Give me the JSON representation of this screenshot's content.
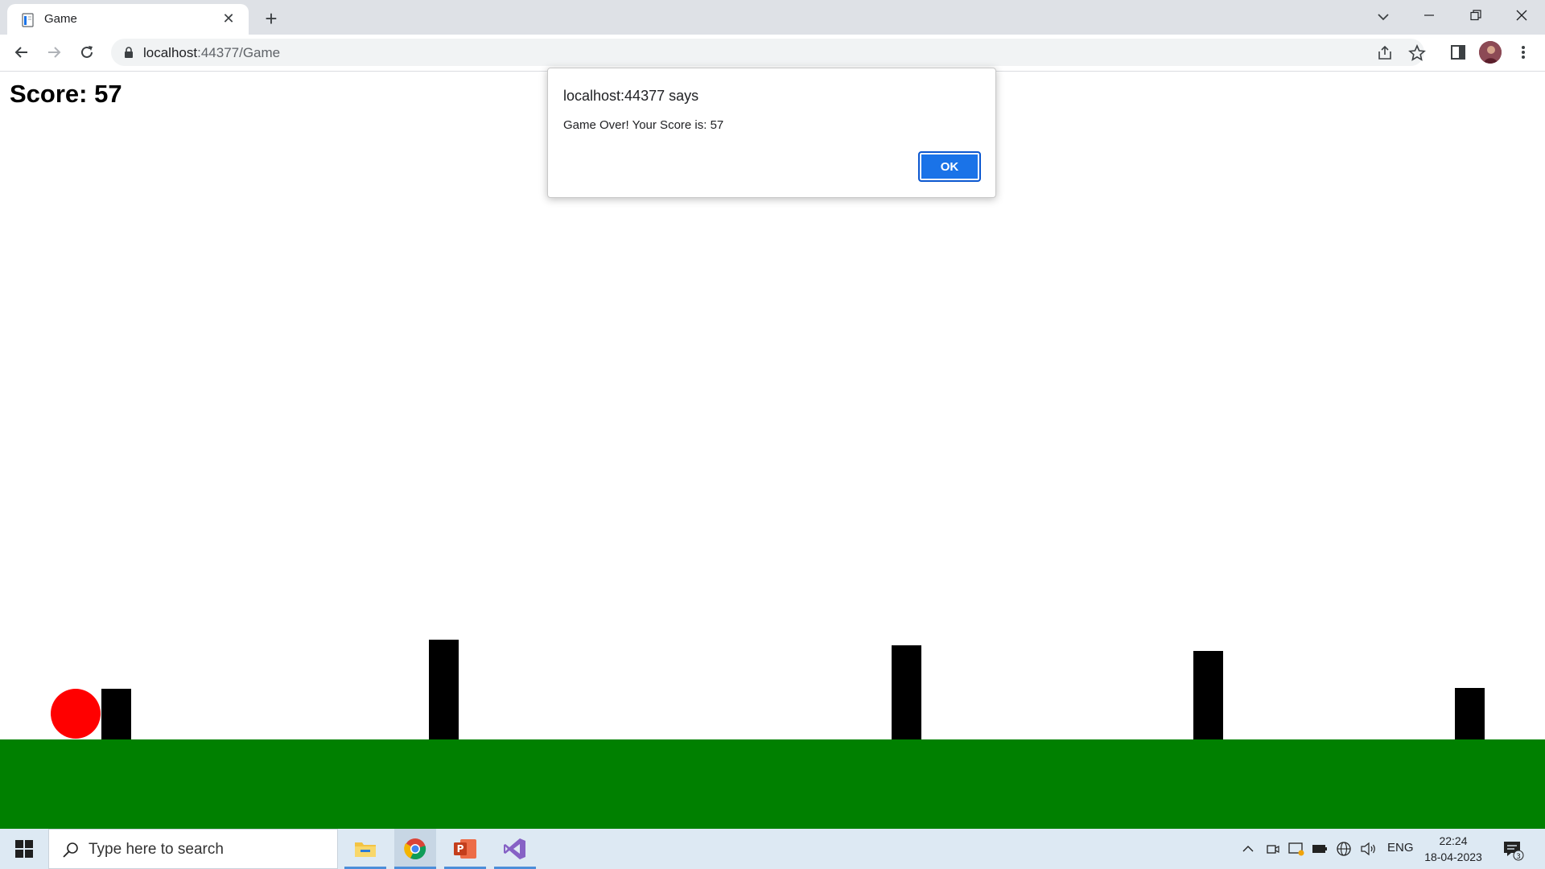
{
  "browser": {
    "tab_title": "Game",
    "tab_close": "✕",
    "new_tab": "+",
    "url_host": "localhost",
    "url_path": ":44377/Game"
  },
  "game": {
    "score_label": "Score: 57",
    "ground_color": "#008000",
    "ball_color": "#ff0000",
    "obstacle_color": "#000000"
  },
  "alert": {
    "title": "localhost:44377 says",
    "message": "Game Over! Your Score is: 57",
    "ok_label": "OK"
  },
  "taskbar": {
    "search_placeholder": "Type here to search",
    "language": "ENG",
    "time": "22:24",
    "date": "18-04-2023",
    "notification_count": "3"
  }
}
